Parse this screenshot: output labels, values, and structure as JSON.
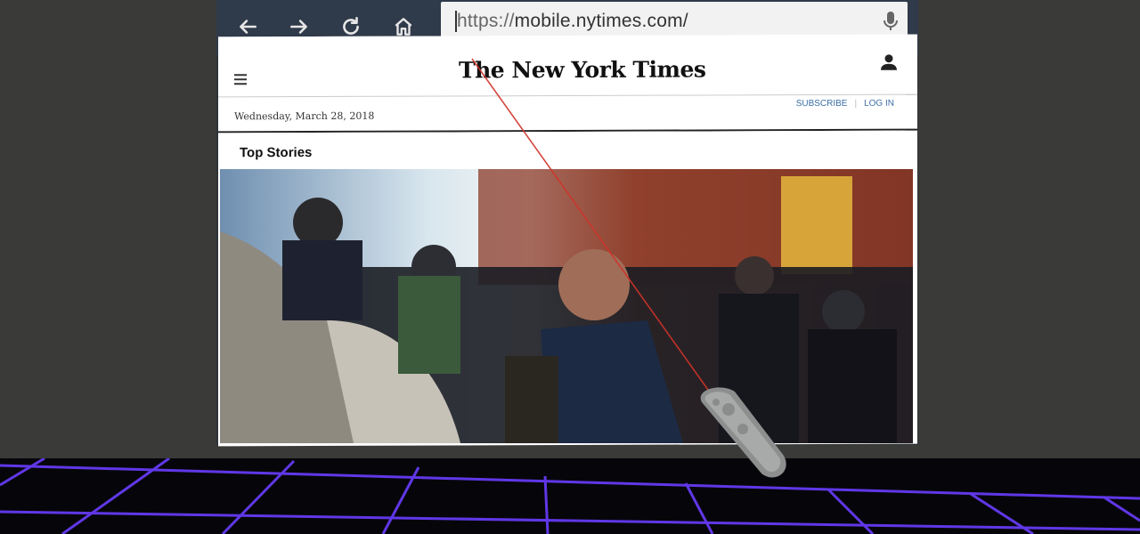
{
  "browser": {
    "url_scheme": "https://",
    "url_rest": "mobile.nytimes.com/",
    "back_icon": "back-arrow-icon",
    "forward_icon": "forward-arrow-icon",
    "reload_icon": "reload-icon",
    "home_icon": "home-icon",
    "mic_icon": "microphone-icon"
  },
  "site": {
    "logo": "The New York Times",
    "date": "Wednesday, March 28, 2018",
    "subscribe": "SUBSCRIBE",
    "separator": "|",
    "login": "LOG IN",
    "menu_icon": "hamburger-menu-icon",
    "account_icon": "user-icon"
  },
  "section": {
    "title": "Top Stories"
  },
  "colors": {
    "toolbar": "#2f3a4a",
    "link": "#3b6ea5",
    "laser": "#d0322a",
    "grid": "#7a3cff"
  }
}
